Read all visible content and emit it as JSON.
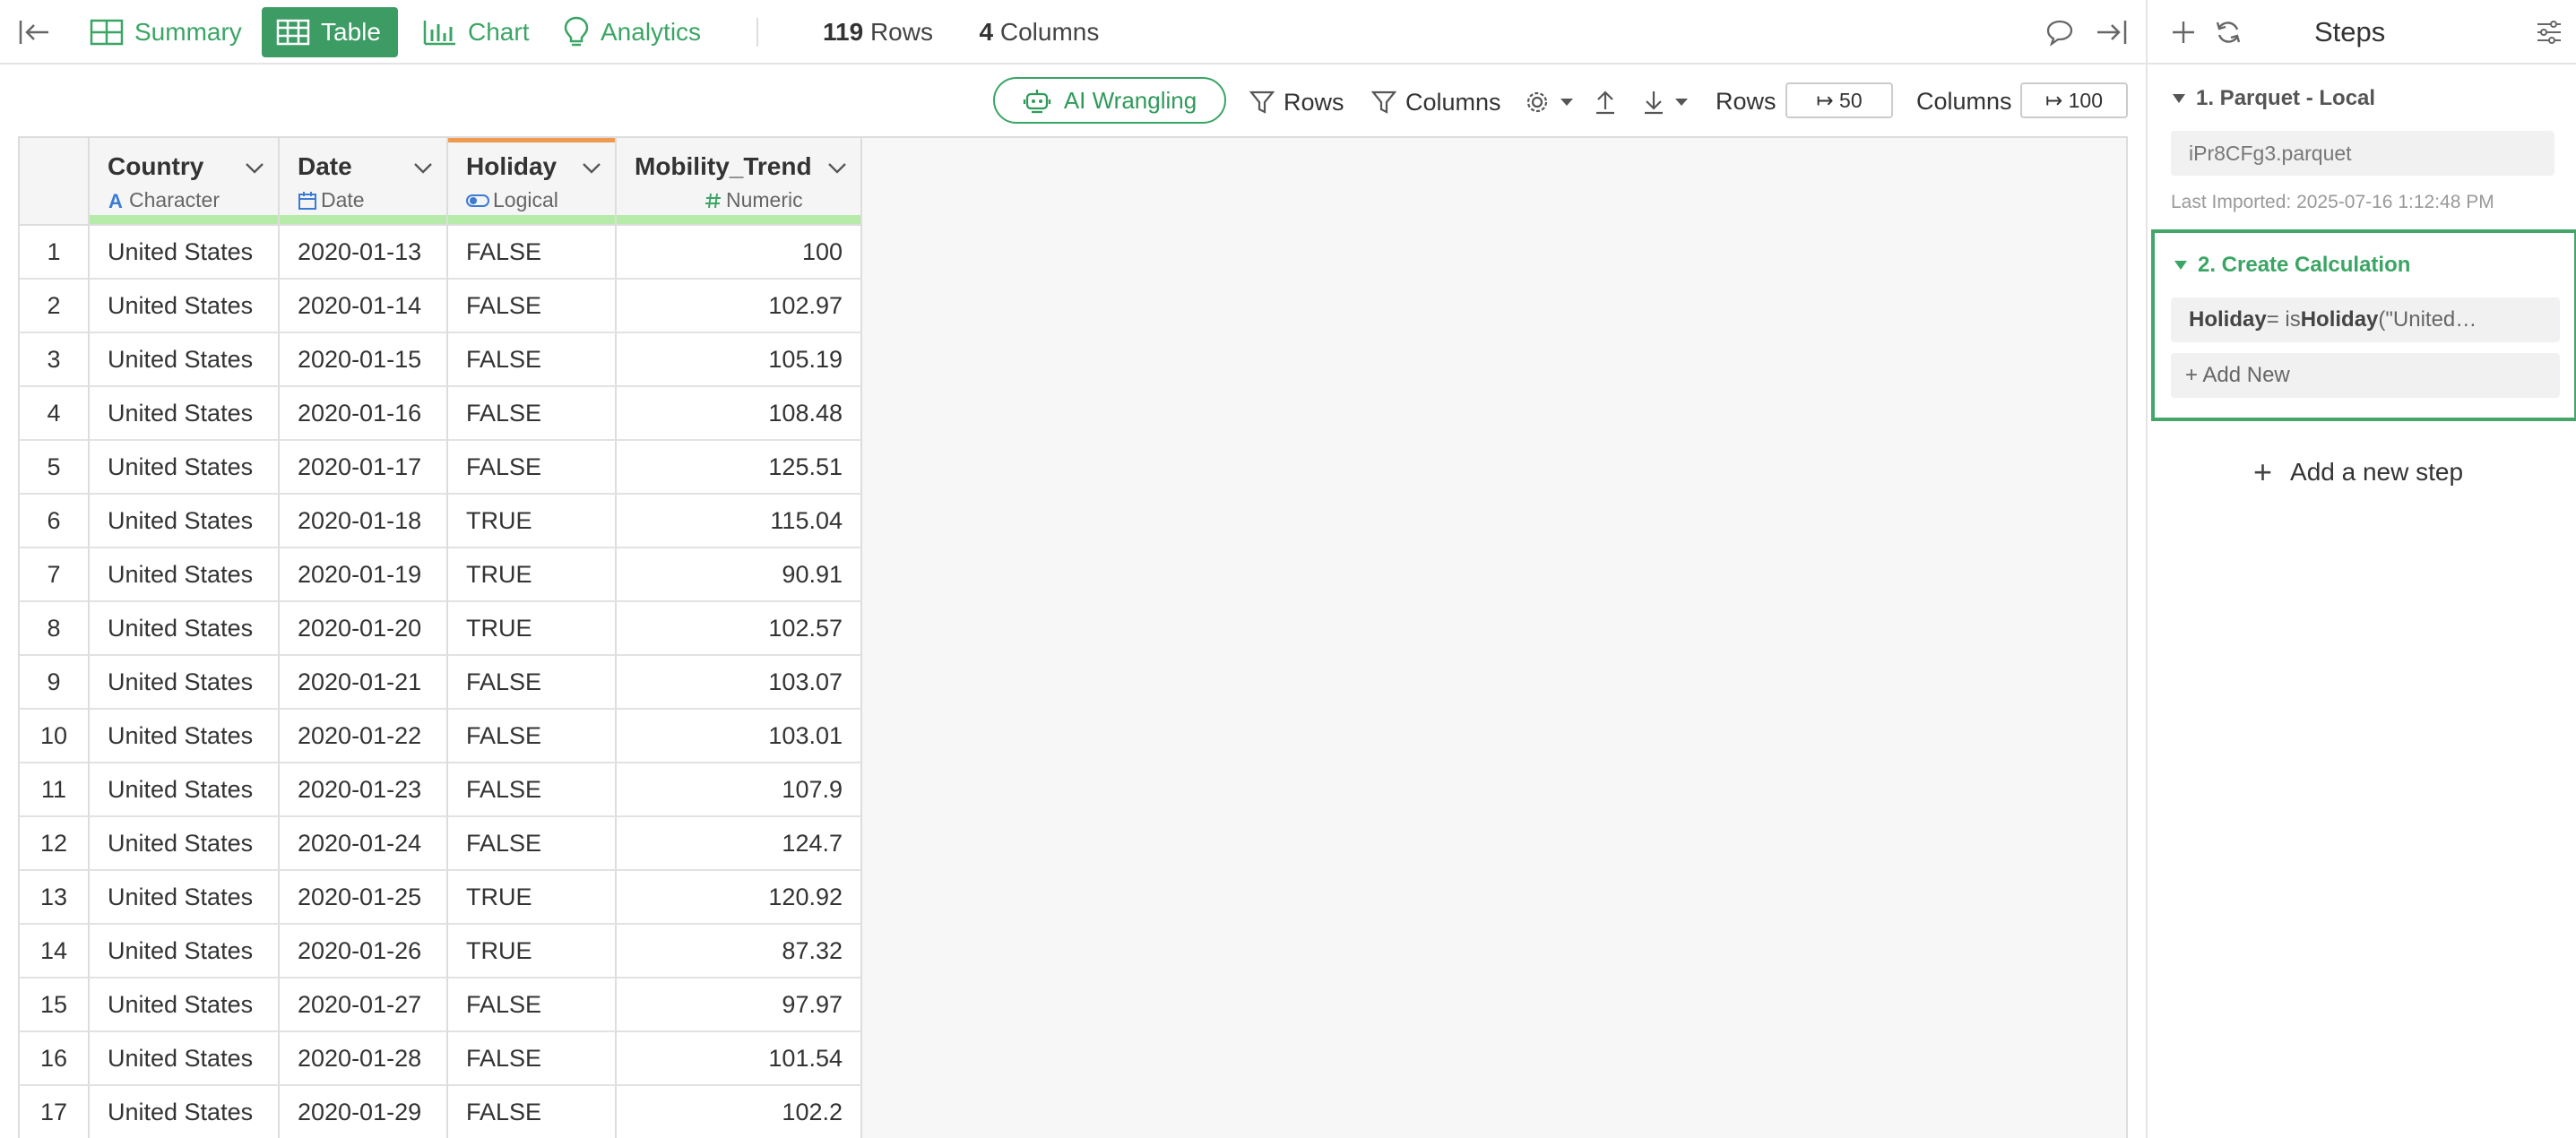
{
  "toolbar": {
    "tabs": [
      {
        "label": "Summary"
      },
      {
        "label": "Table"
      },
      {
        "label": "Chart"
      },
      {
        "label": "Analytics"
      }
    ],
    "rows_count": "119",
    "rows_word": "Rows",
    "cols_count": "4",
    "cols_word": "Columns"
  },
  "toolbar2": {
    "ai_label": "AI Wrangling",
    "rows_filter": "Rows",
    "columns_filter": "Columns",
    "rows_label": "Rows",
    "rows_value": "↦ 50",
    "columns_label": "Columns",
    "columns_value": "↦ 100"
  },
  "table": {
    "columns": [
      {
        "name": "Country",
        "type": "Character"
      },
      {
        "name": "Date",
        "type": "Date"
      },
      {
        "name": "Holiday",
        "type": "Logical"
      },
      {
        "name": "Mobility_Trend",
        "type": "Numeric"
      }
    ],
    "rows": [
      [
        "1",
        "United States",
        "2020-01-13",
        "FALSE",
        "100"
      ],
      [
        "2",
        "United States",
        "2020-01-14",
        "FALSE",
        "102.97"
      ],
      [
        "3",
        "United States",
        "2020-01-15",
        "FALSE",
        "105.19"
      ],
      [
        "4",
        "United States",
        "2020-01-16",
        "FALSE",
        "108.48"
      ],
      [
        "5",
        "United States",
        "2020-01-17",
        "FALSE",
        "125.51"
      ],
      [
        "6",
        "United States",
        "2020-01-18",
        "TRUE",
        "115.04"
      ],
      [
        "7",
        "United States",
        "2020-01-19",
        "TRUE",
        "90.91"
      ],
      [
        "8",
        "United States",
        "2020-01-20",
        "TRUE",
        "102.57"
      ],
      [
        "9",
        "United States",
        "2020-01-21",
        "FALSE",
        "103.07"
      ],
      [
        "10",
        "United States",
        "2020-01-22",
        "FALSE",
        "103.01"
      ],
      [
        "11",
        "United States",
        "2020-01-23",
        "FALSE",
        "107.9"
      ],
      [
        "12",
        "United States",
        "2020-01-24",
        "FALSE",
        "124.7"
      ],
      [
        "13",
        "United States",
        "2020-01-25",
        "TRUE",
        "120.92"
      ],
      [
        "14",
        "United States",
        "2020-01-26",
        "TRUE",
        "87.32"
      ],
      [
        "15",
        "United States",
        "2020-01-27",
        "FALSE",
        "97.97"
      ],
      [
        "16",
        "United States",
        "2020-01-28",
        "FALSE",
        "101.54"
      ],
      [
        "17",
        "United States",
        "2020-01-29",
        "FALSE",
        "102.2"
      ]
    ]
  },
  "steps": {
    "title": "Steps",
    "step1_title": "1. Parquet - Local",
    "step1_file": "iPr8CFg3.parquet",
    "step1_imported": "Last Imported: 2025-07-16 1:12:48 PM",
    "step2_title": "2. Create Calculation",
    "calc_target": "Holiday",
    "calc_eq": " = is",
    "calc_func": "Holiday",
    "calc_args": "(\"United…",
    "add_new": "+ Add New",
    "add_step": "Add a new step"
  },
  "colors": {
    "accent": "#3aa564",
    "active_tab": "#3d9b64",
    "selected_column": "#ef9a4e",
    "quality_bar": "#b7eba9"
  },
  "icons": [
    "collapse-left-icon",
    "grid-icon",
    "table-icon",
    "bar-chart-icon",
    "bulb-icon",
    "comment-icon",
    "collapse-right-icon",
    "plus-icon",
    "refresh-icon",
    "sliders-icon",
    "robot-icon",
    "filter-icon",
    "gear-icon",
    "upload-icon",
    "download-icon"
  ]
}
